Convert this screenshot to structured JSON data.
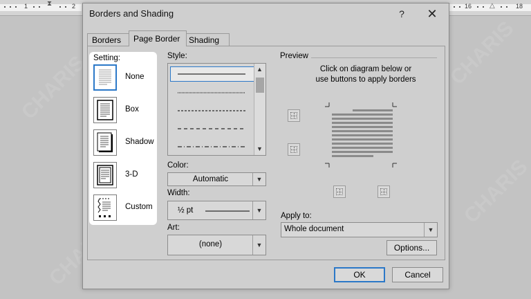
{
  "ruler": {
    "left_numbers": [
      "1",
      "2"
    ],
    "right_numbers": [
      "16",
      "18"
    ]
  },
  "dialog": {
    "title": "Borders and Shading",
    "help_label": "?",
    "close_label": "✕",
    "tabs": [
      {
        "label": "Borders",
        "active": false
      },
      {
        "label": "Page Border",
        "active": true
      },
      {
        "label": "Shading",
        "active": false
      }
    ],
    "setting": {
      "label": "Setting:",
      "items": [
        {
          "label": "None",
          "selected": true
        },
        {
          "label": "Box",
          "selected": false
        },
        {
          "label": "Shadow",
          "selected": false
        },
        {
          "label": "3-D",
          "selected": false
        },
        {
          "label": "Custom",
          "selected": false
        }
      ]
    },
    "style": {
      "label": "Style:",
      "selected_index": 0
    },
    "color": {
      "label": "Color:",
      "value": "Automatic"
    },
    "width": {
      "label": "Width:",
      "value": "½ pt"
    },
    "art": {
      "label": "Art:",
      "value": "(none)"
    },
    "preview": {
      "label": "Preview",
      "instructions_line1": "Click on diagram below or",
      "instructions_line2": "use buttons to apply borders"
    },
    "apply_to": {
      "label": "Apply to:",
      "value": "Whole document"
    },
    "options_label": "Options...",
    "ok_label": "OK",
    "cancel_label": "Cancel"
  },
  "watermark": "CHARIS",
  "colors": {
    "accent": "#2b78c8",
    "dialog_bg": "#cfcfcf",
    "highlight": "#ffffff"
  }
}
